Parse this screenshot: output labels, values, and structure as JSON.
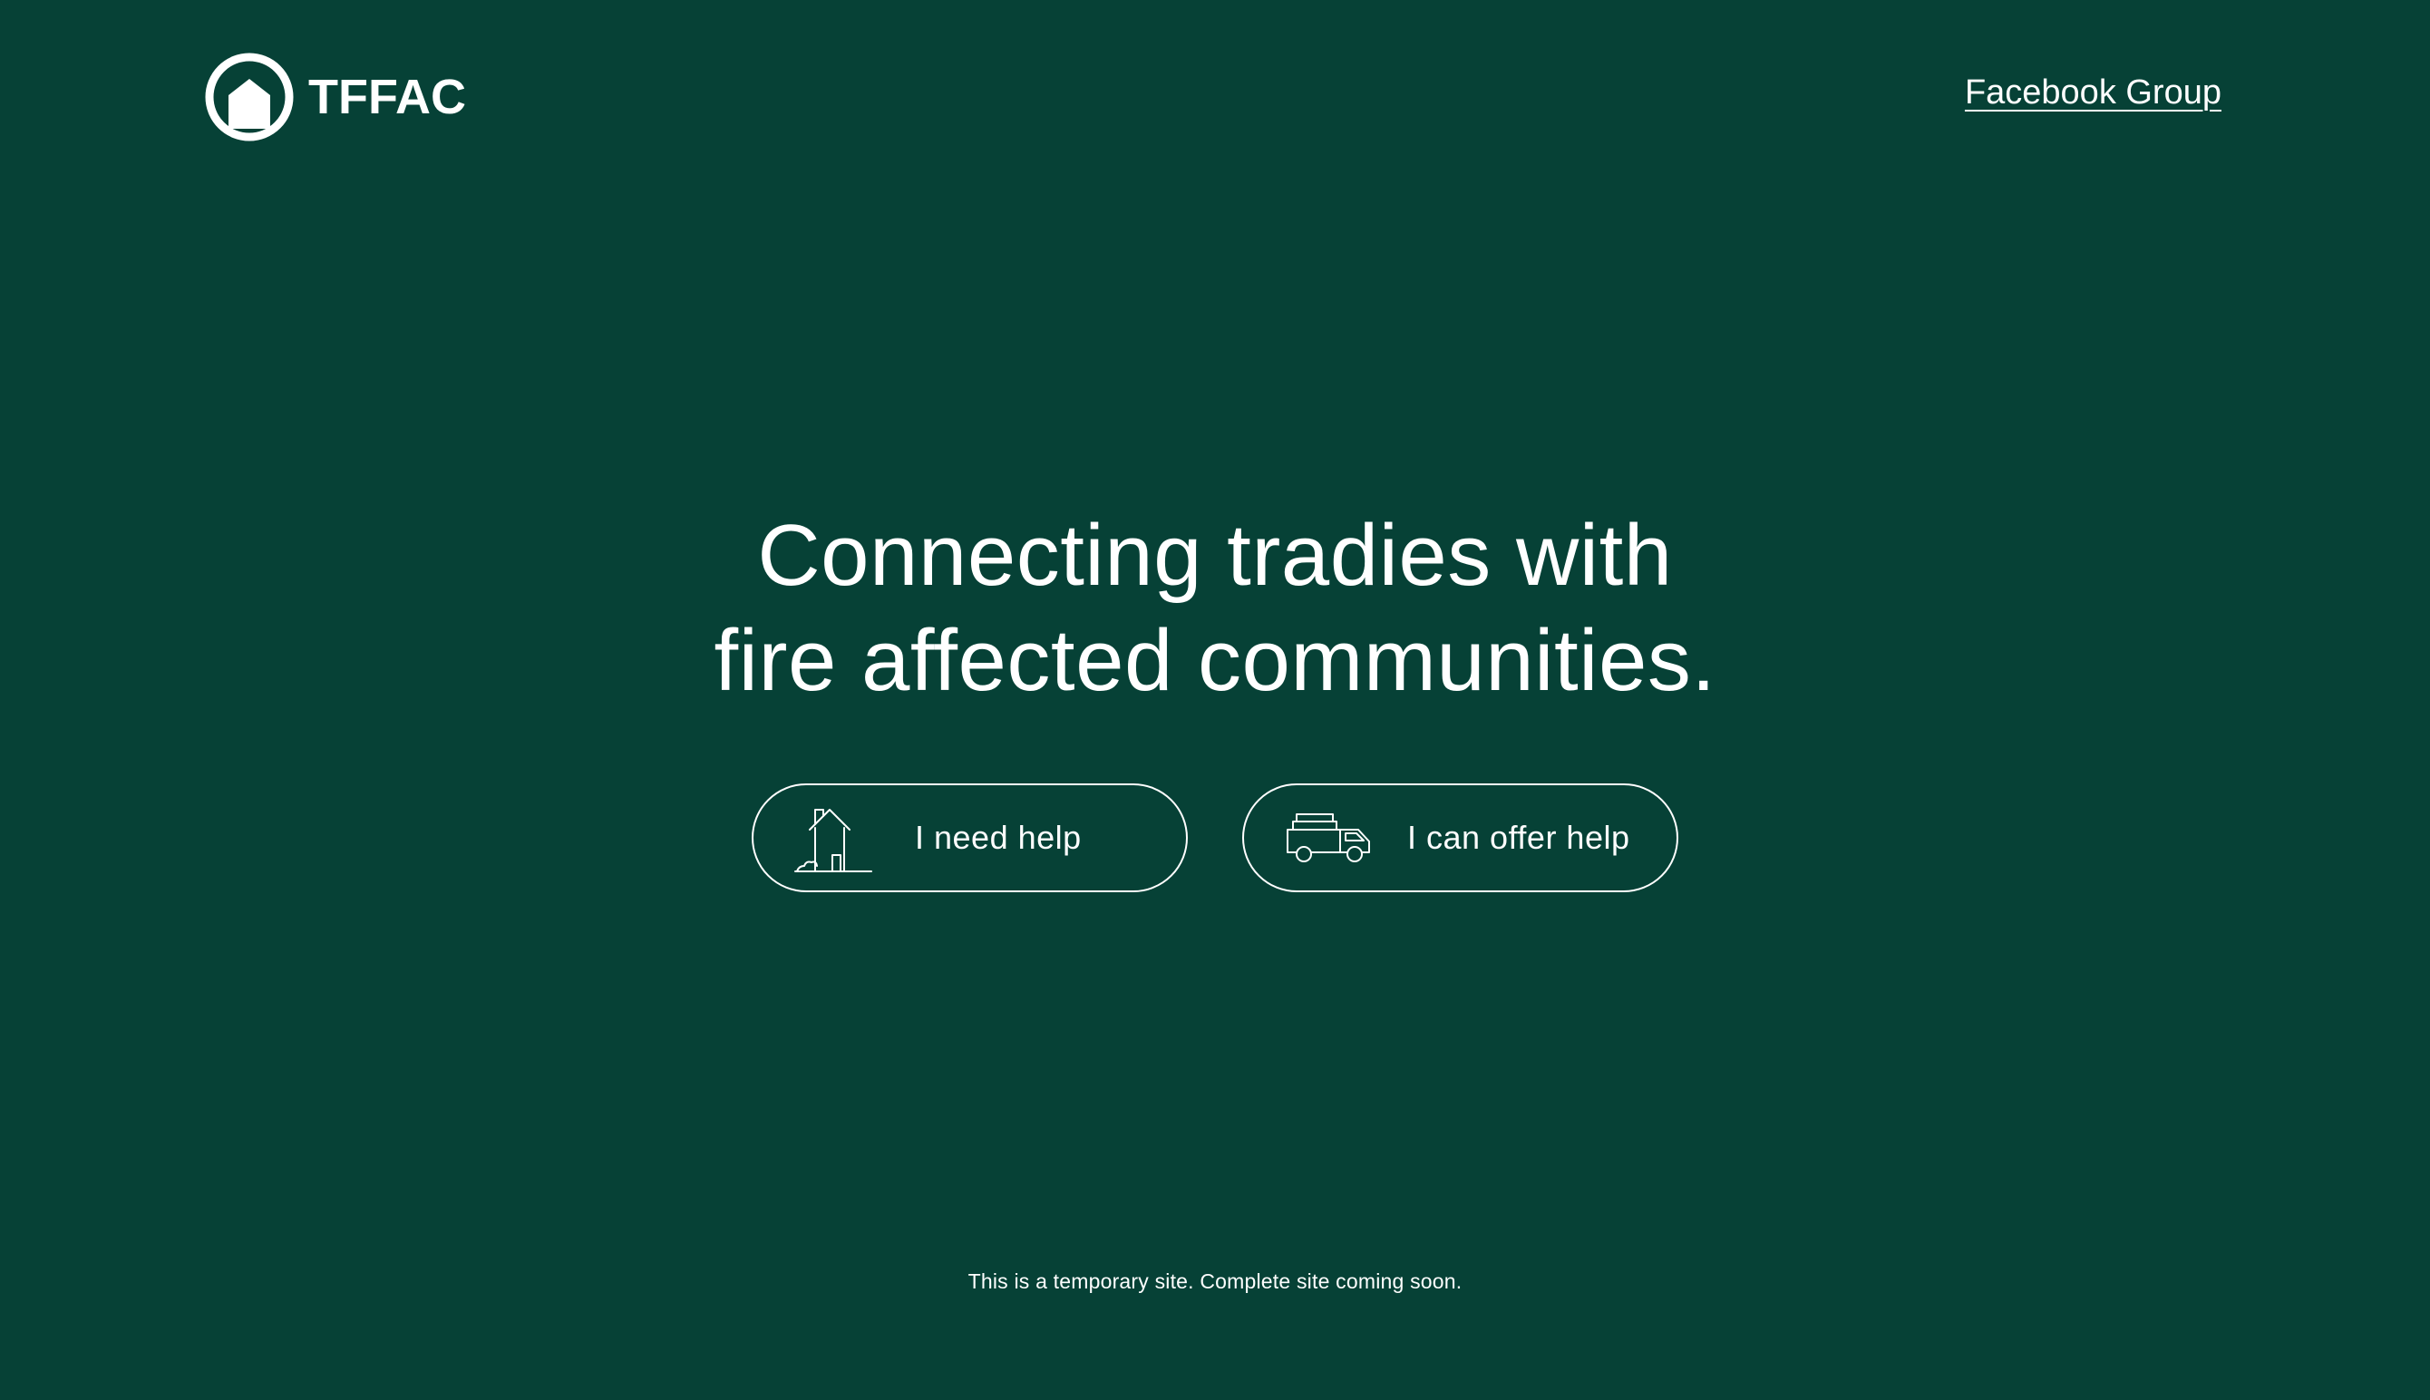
{
  "header": {
    "logo_text": "TFFAC",
    "logo_icon": "house-in-circle-icon",
    "facebook_link": "Facebook Group"
  },
  "hero": {
    "title_line1": "Connecting tradies with",
    "title_line2": "fire affected communities."
  },
  "actions": [
    {
      "label": "I need help",
      "icon": "house-icon"
    },
    {
      "label": "I can offer help",
      "icon": "truck-icon"
    }
  ],
  "footer": {
    "note": "This is a temporary site. Complete site coming soon."
  },
  "colors": {
    "background": "#064136",
    "foreground": "#ffffff"
  }
}
